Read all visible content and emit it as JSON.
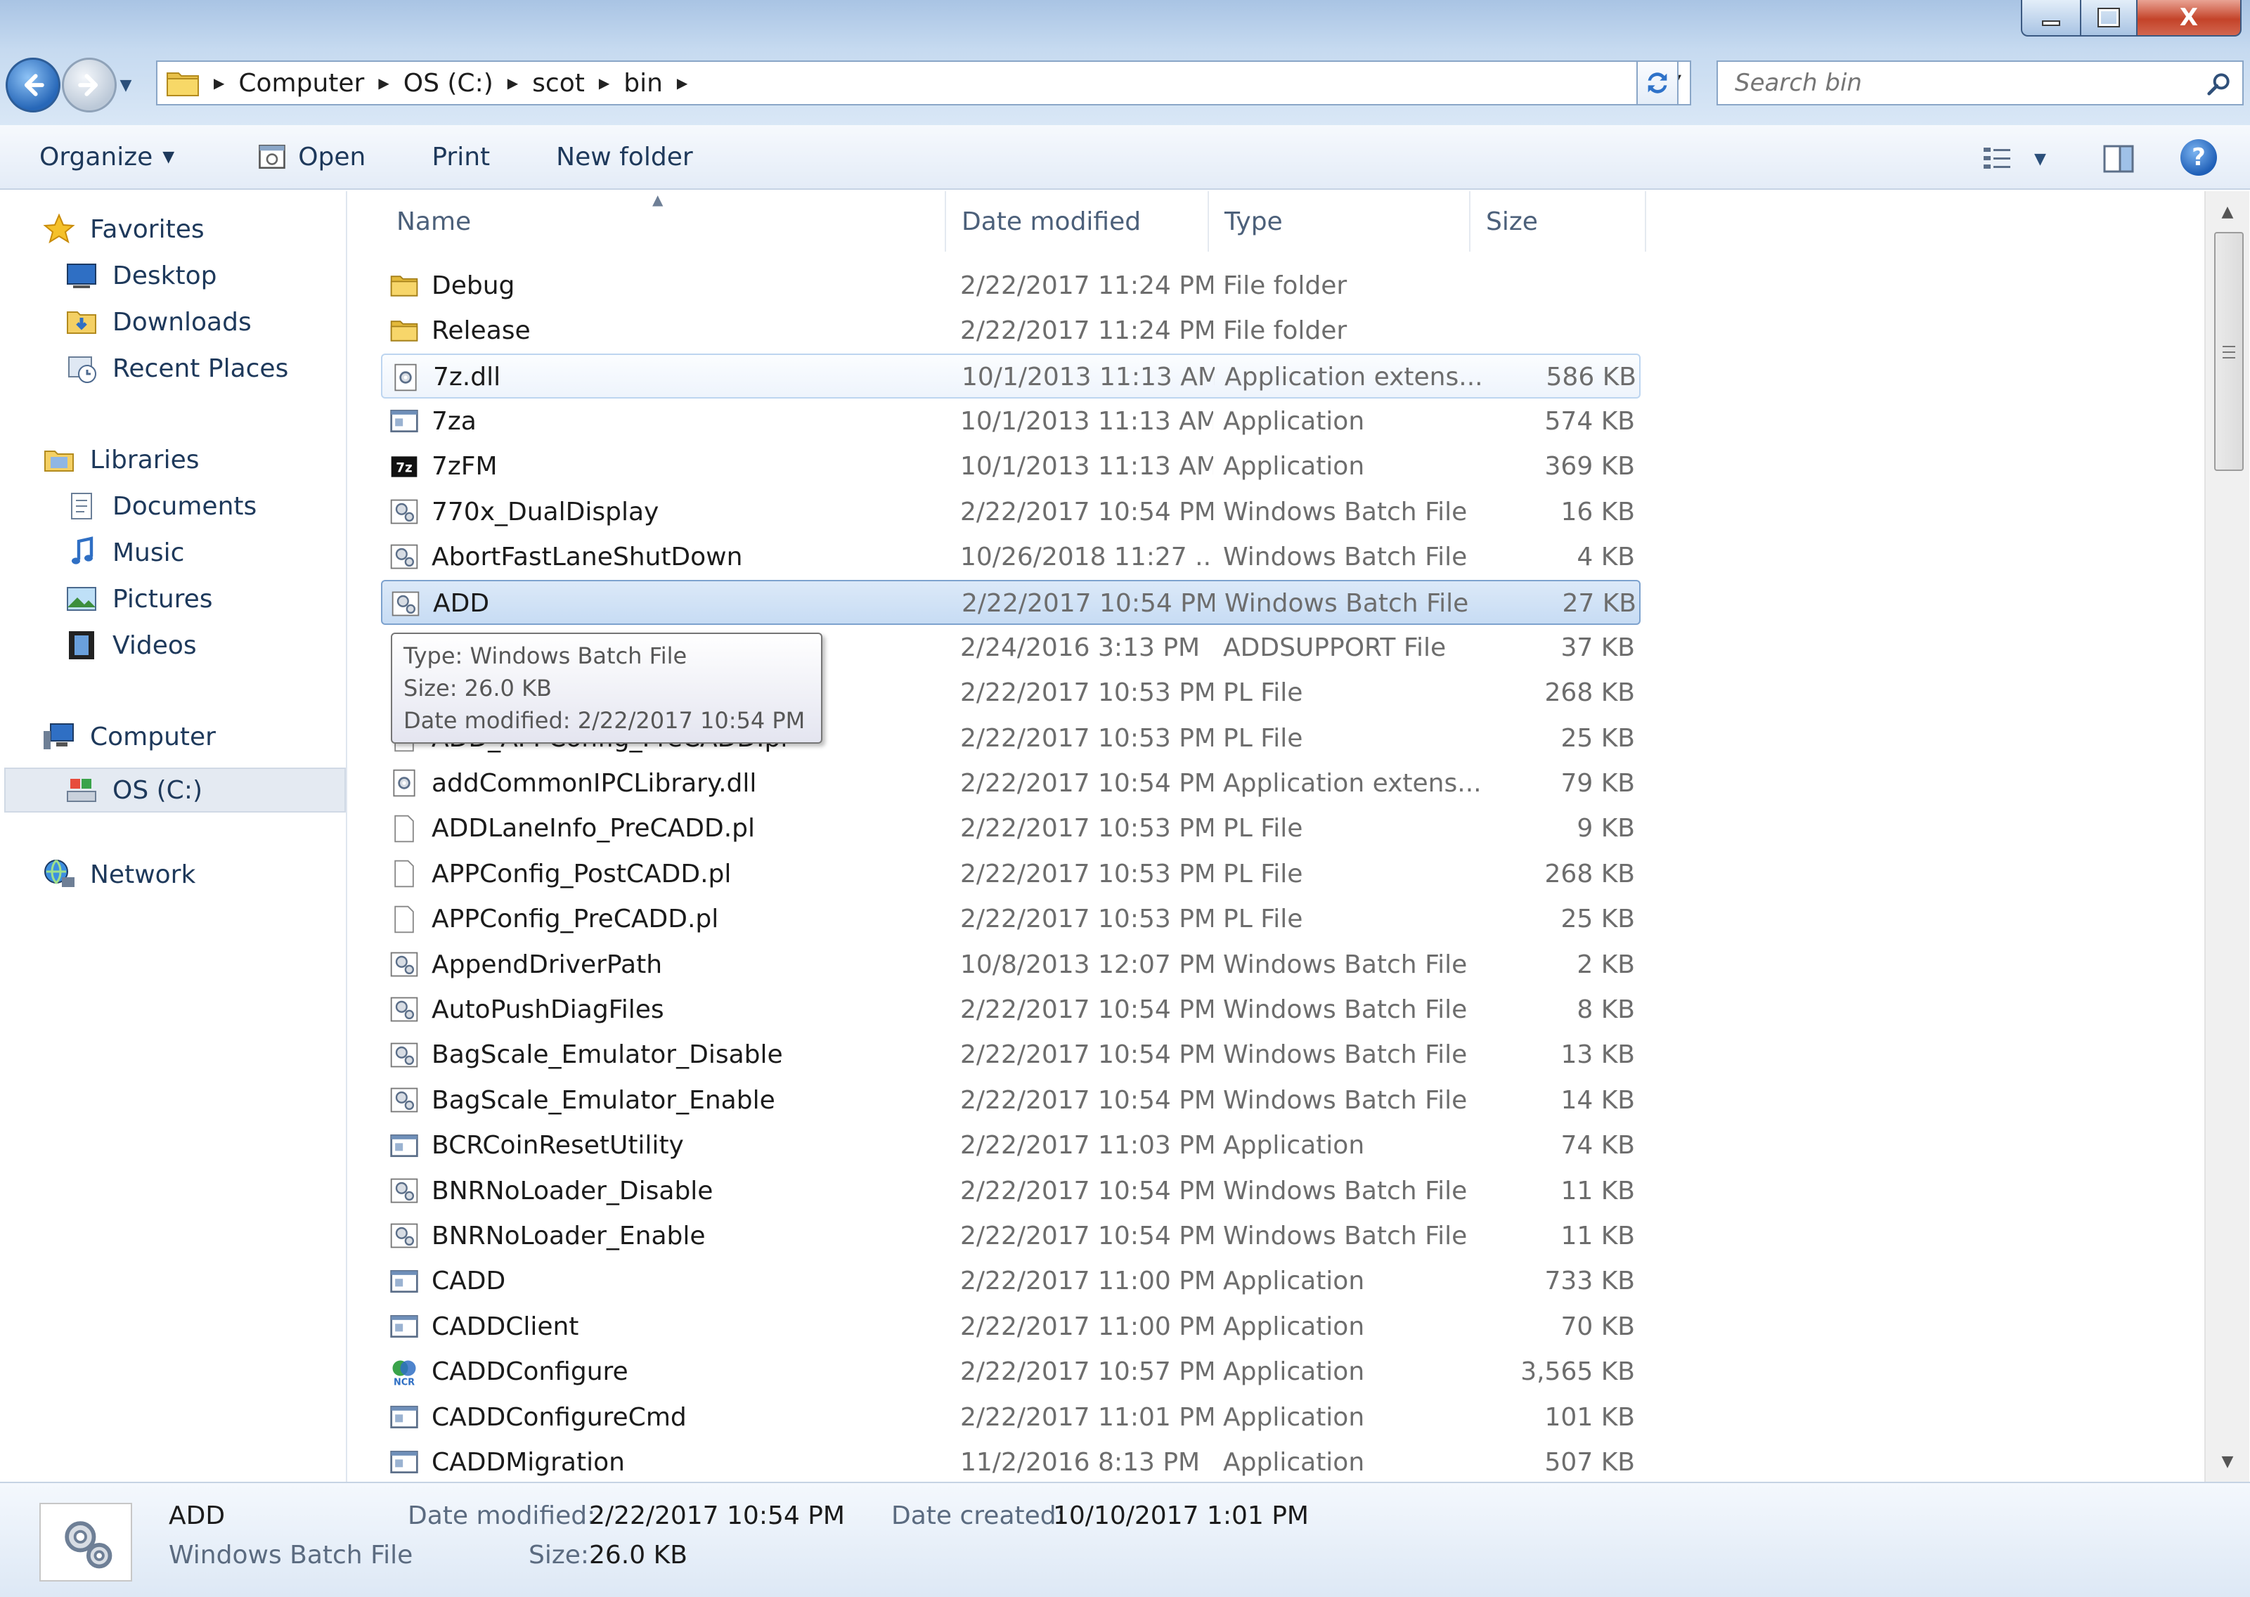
{
  "window": {
    "controls": {
      "close": "X"
    }
  },
  "address": {
    "crumbs": [
      "Computer",
      "OS (C:)",
      "scot",
      "bin"
    ]
  },
  "search": {
    "placeholder": "Search bin"
  },
  "toolbar": {
    "organize": "Organize",
    "open": "Open",
    "print": "Print",
    "new_folder": "New folder",
    "help": "?"
  },
  "nav": {
    "favorites": "Favorites",
    "desktop": "Desktop",
    "downloads": "Downloads",
    "recent": "Recent Places",
    "libraries": "Libraries",
    "documents": "Documents",
    "music": "Music",
    "pictures": "Pictures",
    "videos": "Videos",
    "computer": "Computer",
    "os_c": "OS (C:)",
    "network": "Network"
  },
  "columns": {
    "name": "Name",
    "date": "Date modified",
    "type": "Type",
    "size": "Size"
  },
  "files": [
    {
      "name": "Debug",
      "date": "2/22/2017 11:24 PM",
      "type": "File folder",
      "size": "",
      "icon": "folder-icon"
    },
    {
      "name": "Release",
      "date": "2/22/2017 11:24 PM",
      "type": "File folder",
      "size": "",
      "icon": "folder-icon"
    },
    {
      "name": "7z.dll",
      "date": "10/1/2013 11:13 AM",
      "type": "Application extens...",
      "size": "586 KB",
      "icon": "dll-icon"
    },
    {
      "name": "7za",
      "date": "10/1/2013 11:13 AM",
      "type": "Application",
      "size": "574 KB",
      "icon": "app-icon"
    },
    {
      "name": "7zFM",
      "date": "10/1/2013 11:13 AM",
      "type": "Application",
      "size": "369 KB",
      "icon": "7z-icon"
    },
    {
      "name": "770x_DualDisplay",
      "date": "2/22/2017 10:54 PM",
      "type": "Windows Batch File",
      "size": "16 KB",
      "icon": "batch-icon"
    },
    {
      "name": "AbortFastLaneShutDown",
      "date": "10/26/2018 11:27 ...",
      "type": "Windows Batch File",
      "size": "4 KB",
      "icon": "batch-icon"
    },
    {
      "name": "ADD",
      "date": "2/22/2017 10:54 PM",
      "type": "Windows Batch File",
      "size": "27 KB",
      "icon": "batch-icon"
    },
    {
      "name": "",
      "date": "2/24/2016 3:13 PM",
      "type": "ADDSUPPORT File",
      "size": "37 KB",
      "icon": "blank-file-icon"
    },
    {
      "name": "",
      "date": "2/22/2017 10:53 PM",
      "type": "PL File",
      "size": "268 KB",
      "icon": "blank-file-icon"
    },
    {
      "name": "ADD_APPConfig_PreCADD.pl",
      "date": "2/22/2017 10:53 PM",
      "type": "PL File",
      "size": "25 KB",
      "icon": "blank-file-icon"
    },
    {
      "name": "addCommonIPCLibrary.dll",
      "date": "2/22/2017 10:54 PM",
      "type": "Application extens...",
      "size": "79 KB",
      "icon": "dll-icon"
    },
    {
      "name": "ADDLaneInfo_PreCADD.pl",
      "date": "2/22/2017 10:53 PM",
      "type": "PL File",
      "size": "9 KB",
      "icon": "blank-file-icon"
    },
    {
      "name": "APPConfig_PostCADD.pl",
      "date": "2/22/2017 10:53 PM",
      "type": "PL File",
      "size": "268 KB",
      "icon": "blank-file-icon"
    },
    {
      "name": "APPConfig_PreCADD.pl",
      "date": "2/22/2017 10:53 PM",
      "type": "PL File",
      "size": "25 KB",
      "icon": "blank-file-icon"
    },
    {
      "name": "AppendDriverPath",
      "date": "10/8/2013 12:07 PM",
      "type": "Windows Batch File",
      "size": "2 KB",
      "icon": "batch-icon"
    },
    {
      "name": "AutoPushDiagFiles",
      "date": "2/22/2017 10:54 PM",
      "type": "Windows Batch File",
      "size": "8 KB",
      "icon": "batch-icon"
    },
    {
      "name": "BagScale_Emulator_Disable",
      "date": "2/22/2017 10:54 PM",
      "type": "Windows Batch File",
      "size": "13 KB",
      "icon": "batch-icon"
    },
    {
      "name": "BagScale_Emulator_Enable",
      "date": "2/22/2017 10:54 PM",
      "type": "Windows Batch File",
      "size": "14 KB",
      "icon": "batch-icon"
    },
    {
      "name": "BCRCoinResetUtility",
      "date": "2/22/2017 11:03 PM",
      "type": "Application",
      "size": "74 KB",
      "icon": "app-icon"
    },
    {
      "name": "BNRNoLoader_Disable",
      "date": "2/22/2017 10:54 PM",
      "type": "Windows Batch File",
      "size": "11 KB",
      "icon": "batch-icon"
    },
    {
      "name": "BNRNoLoader_Enable",
      "date": "2/22/2017 10:54 PM",
      "type": "Windows Batch File",
      "size": "11 KB",
      "icon": "batch-icon"
    },
    {
      "name": "CADD",
      "date": "2/22/2017 11:00 PM",
      "type": "Application",
      "size": "733 KB",
      "icon": "app-icon"
    },
    {
      "name": "CADDClient",
      "date": "2/22/2017 11:00 PM",
      "type": "Application",
      "size": "70 KB",
      "icon": "app-icon"
    },
    {
      "name": "CADDConfigure",
      "date": "2/22/2017 10:57 PM",
      "type": "Application",
      "size": "3,565 KB",
      "icon": "ncr-icon"
    },
    {
      "name": "CADDConfigureCmd",
      "date": "2/22/2017 11:01 PM",
      "type": "Application",
      "size": "101 KB",
      "icon": "app-icon"
    },
    {
      "name": "CADDMigration",
      "date": "11/2/2016 8:13 PM",
      "type": "Application",
      "size": "507 KB",
      "icon": "app-icon"
    }
  ],
  "tooltip": {
    "type": "Type: Windows Batch File",
    "size": "Size: 26.0 KB",
    "date": "Date modified: 2/22/2017 10:54 PM"
  },
  "details": {
    "name": "ADD",
    "type": "Windows Batch File",
    "date_modified_label": "Date modified:",
    "date_modified": "2/22/2017 10:54 PM",
    "size_label": "Size:",
    "size": "26.0 KB",
    "date_created_label": "Date created:",
    "date_created": "10/10/2017 1:01 PM"
  },
  "colors": {
    "selection": "#c7dcf4",
    "accent": "#1e395b"
  }
}
